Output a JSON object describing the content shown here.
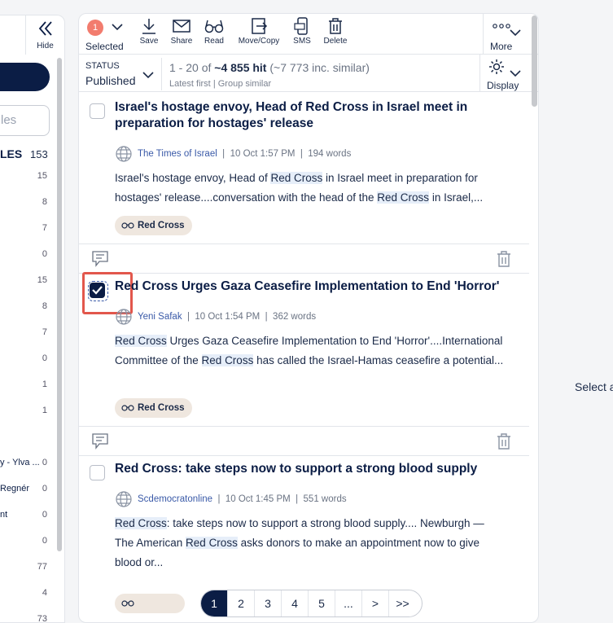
{
  "left": {
    "hide_label": "Hide",
    "input_placeholder": "les",
    "heading": "LES",
    "heading_count": "153",
    "rows": [
      {
        "label": "",
        "count": "15"
      },
      {
        "label": "",
        "count": "8"
      },
      {
        "label": "",
        "count": "7"
      },
      {
        "label": "",
        "count": "0"
      },
      {
        "label": "",
        "count": "15"
      },
      {
        "label": "",
        "count": "8"
      },
      {
        "label": "",
        "count": "7"
      },
      {
        "label": "",
        "count": "0"
      },
      {
        "label": "",
        "count": "1"
      },
      {
        "label": "",
        "count": "1"
      },
      {
        "label": "y - Ylva ...",
        "count": "0"
      },
      {
        "label": "Regnér",
        "count": "0"
      },
      {
        "label": "nt",
        "count": "0"
      },
      {
        "label": "",
        "count": "0"
      },
      {
        "label": "",
        "count": "77"
      },
      {
        "label": "",
        "count": "4"
      },
      {
        "label": "",
        "count": "73"
      }
    ]
  },
  "toolbar": {
    "selected_count": "1",
    "selected_label": "Selected",
    "save": "Save",
    "share": "Share",
    "read": "Read",
    "move_copy": "Move/Copy",
    "sms": "SMS",
    "delete": "Delete",
    "more": "More"
  },
  "status": {
    "label": "STATUS",
    "value": "Published",
    "hits_prefix": "1 - 20 of ",
    "hits_count": "~4 855 hit",
    "hits_suffix": " (~7 773 inc. similar)",
    "sort": "Latest first",
    "group": "Group similar",
    "display": "Display"
  },
  "articles": [
    {
      "title": "Israel's hostage envoy, Head of Red Cross in Israel meet in preparation for hostages' release",
      "source": "The Times of Israel",
      "date": "10 Oct 1:57 PM",
      "words": "194 words",
      "snippet_parts": [
        "Israel's hostage envoy, Head of ",
        "Red Cross",
        " in Israel meet in preparation for hostages' release....conversation with the head of the ",
        "Red Cross",
        " in Israel,..."
      ],
      "tag": "Red Cross",
      "checked": false
    },
    {
      "title": "Red Cross Urges Gaza Ceasefire Implementation to End 'Horror'",
      "source": "Yeni Safak",
      "date": "10 Oct 1:54 PM",
      "words": "362 words",
      "snippet_parts": [
        "Red Cross",
        " Urges Gaza Ceasefire Implementation to End 'Horror'....International Committee of the ",
        "Red Cross",
        " has called the Israel-Hamas ceasefire a potential..."
      ],
      "tag": "Red Cross",
      "checked": true
    },
    {
      "title": "Red Cross: take steps now to support a strong blood supply",
      "source": "Scdemocratonline",
      "date": "10 Oct 1:45 PM",
      "words": "551 words",
      "snippet_parts": [
        "Red Cross",
        ": take steps now to support a strong blood supply.... Newburgh — The American ",
        "Red Cross",
        " asks donors to make an appointment now to give blood or..."
      ],
      "tag": "",
      "checked": false
    }
  ],
  "pagination": [
    "1",
    "2",
    "3",
    "4",
    "5",
    "...",
    ">",
    ">>"
  ],
  "right_text": "Select a"
}
